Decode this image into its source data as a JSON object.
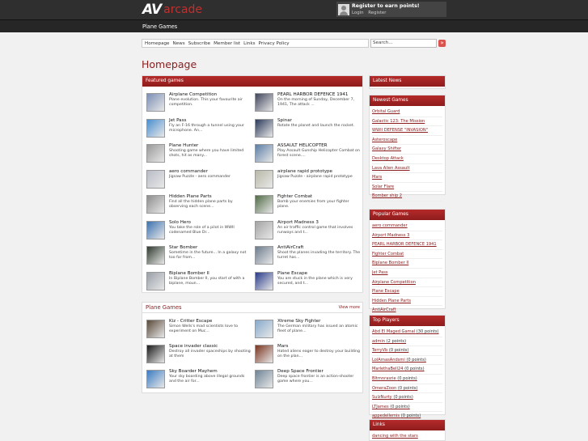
{
  "header": {
    "logo_mark": "AV",
    "logo_text": "arcade",
    "register_title": "Register to earn points!",
    "login": "Login",
    "register": "Register",
    "category": "Plane Games"
  },
  "nav": [
    "Homepage",
    "News",
    "Subscribe",
    "Member list",
    "Links",
    "Privacy Policy"
  ],
  "search": {
    "placeholder": "Search..."
  },
  "page_title": "Homepage",
  "featured": {
    "title": "Featured games",
    "games": [
      {
        "title": "Airplane Competition",
        "desc": "Plane evolution. This your favourite air competition.",
        "color": "#7b8fb5"
      },
      {
        "title": "PEARL HARBOR DEFENCE 1941",
        "desc": "On the morning of Sunday, December 7, 1941, The attack ...",
        "color": "#40465c"
      },
      {
        "title": "Jet Pass",
        "desc": "Fly an F-16 through a tunnel using your microphone. An...",
        "color": "#4a8fcf"
      },
      {
        "title": "Spinar",
        "desc": "Rotate the planet and launch the rocket.",
        "color": "#2b3a5a"
      },
      {
        "title": "Plane Hunter",
        "desc": "Shooting game where you have limited shots, hit as many...",
        "color": "#999999"
      },
      {
        "title": "ASSAULT HELICOPTER",
        "desc": "Play Assault Gunship Helicopter Combat on forest scene....",
        "color": "#5d7ea6"
      },
      {
        "title": "aero commander",
        "desc": "Jigsaw Puzzle - aero commander",
        "color": "#b8bcc6"
      },
      {
        "title": "airplane rapid prototype",
        "desc": "Jigsaw Puzzle - airplane rapid prototype",
        "color": "#b9b8a8"
      },
      {
        "title": "Hidden Plane Parts",
        "desc": "Find all the hidden plane parts by observing each scene...",
        "color": "#8d8d8d"
      },
      {
        "title": "Fighter Combat",
        "desc": "Bomb your enemies from your fighter plane.",
        "color": "#526b48"
      },
      {
        "title": "Solo Hero",
        "desc": "You take the role of a pilot in WWII codenamed Blue Dr...",
        "color": "#3c72b0"
      },
      {
        "title": "Airport Madness 3",
        "desc": "An air traffic control game that involves runways and t...",
        "color": "#a4a4a4"
      },
      {
        "title": "Star Bomber",
        "desc": "Sometime in the future... In a galaxy not too far from...",
        "color": "#2f3a2f"
      },
      {
        "title": "AntiAirCraft",
        "desc": "Shoot the planes invading the territory. The turret has...",
        "color": "#6d7c8e"
      },
      {
        "title": "Biplane Bomber II",
        "desc": "In Biplane Bomber II, you start of with a biplane, moun...",
        "color": "#9aa0a8"
      },
      {
        "title": "Plane Escape",
        "desc": "You are stuck in the plane which is very secured, and t...",
        "color": "#2a3c8a"
      }
    ]
  },
  "plane_games": {
    "title": "Plane Games",
    "more": "View more",
    "games": [
      {
        "title": "Kiz - Critter Escape",
        "desc": "Simon Wells's mad scientists love to experiment on Muc...",
        "color": "#5a4a3a"
      },
      {
        "title": "Xtreme Sky Fighter",
        "desc": "The German military has issued an atomic fleet of plane...",
        "color": "#87aacc"
      },
      {
        "title": "Space invader classic",
        "desc": "Destroy all invader spaceships by shooting at them",
        "color": "#1a1a1a"
      },
      {
        "title": "Mars",
        "desc": "Hated aliens eager to destroy your building on the plan...",
        "color": "#7a3520"
      },
      {
        "title": "Sky Boarder Mayhem",
        "desc": "Your sky boarding above illegal grounds and the air for...",
        "color": "#3a7cc2"
      },
      {
        "title": "Deep Space Frontier",
        "desc": "Deep space frontier is an action-shooter game where you...",
        "color": "#6f8496"
      }
    ]
  },
  "sidebar": {
    "latest_news": {
      "title": "Latest News"
    },
    "newest": {
      "title": "Newest Games",
      "items": [
        "Orbital Guard",
        "Galactic 123: The Mission",
        "WWII DEFENSE \"INVASION\"",
        "Asteroscape",
        "Galaxy Shifter",
        "Desktop Attack",
        "Lava Alien Assault",
        "Mars",
        "Solar Flare",
        "Bomber ship 2"
      ]
    },
    "popular": {
      "title": "Popular Games",
      "items": [
        "aero commander",
        "Airport Madness 3",
        "PEARL HARBOR DEFENCE 1941",
        "Fighter Combat",
        "Biplane Bomber II",
        "Jet Pass",
        "Airplane Competition",
        "Plane Escape",
        "Hidden Plane Parts",
        "AntiAirCraft"
      ]
    },
    "players": {
      "title": "Top Players",
      "items": [
        {
          "name": "Abd El Maged Gamal",
          "pts": "(30 points)"
        },
        {
          "name": "admin",
          "pts": "(2 points)"
        },
        {
          "name": "TerryVb",
          "pts": "(0 points)"
        },
        {
          "name": "LolArnasAndsmi",
          "pts": "(0 points)"
        },
        {
          "name": "MarlethaBell24",
          "pts": "(0 points)"
        },
        {
          "name": "Bltmnrasrie",
          "pts": "(0 points)"
        },
        {
          "name": "OmeraZoon",
          "pts": "(0 points)"
        },
        {
          "name": "SulzNurty",
          "pts": "(0 points)"
        },
        {
          "name": "LTJames",
          "pts": "(0 points)"
        },
        {
          "name": "appedellemis",
          "pts": "(0 points)"
        }
      ]
    },
    "links": {
      "title": "Links",
      "items": [
        "dancing with the stars"
      ]
    }
  }
}
